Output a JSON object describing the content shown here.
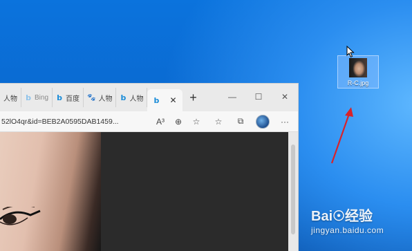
{
  "desktop": {
    "icon_label": "R-C.jpg"
  },
  "browser": {
    "tabs": [
      {
        "icon": "edge-tab-icon",
        "label": "人物"
      },
      {
        "icon": "bing-icon",
        "label": "Bing"
      },
      {
        "icon": "bing-icon",
        "label": "百度"
      },
      {
        "icon": "baidu-paw-icon",
        "label": "人物"
      },
      {
        "icon": "bing-icon",
        "label": "人物"
      },
      {
        "icon": "bing-icon",
        "label": ""
      }
    ],
    "active_tab_close": "✕",
    "new_tab": "+",
    "window_controls": {
      "minimize": "—",
      "maximize": "☐",
      "close": "✕"
    },
    "url": "52lO4qr&id=BEB2A0595DAB1459...",
    "toolbar": {
      "read_aloud": "A³",
      "zoom": "⊕",
      "add_favorite": "☆",
      "favorites": "☆",
      "collections": "⧉",
      "more": "···"
    }
  },
  "watermark": {
    "logo": "Bai☉经验",
    "url": "jingyan.baidu.com"
  }
}
